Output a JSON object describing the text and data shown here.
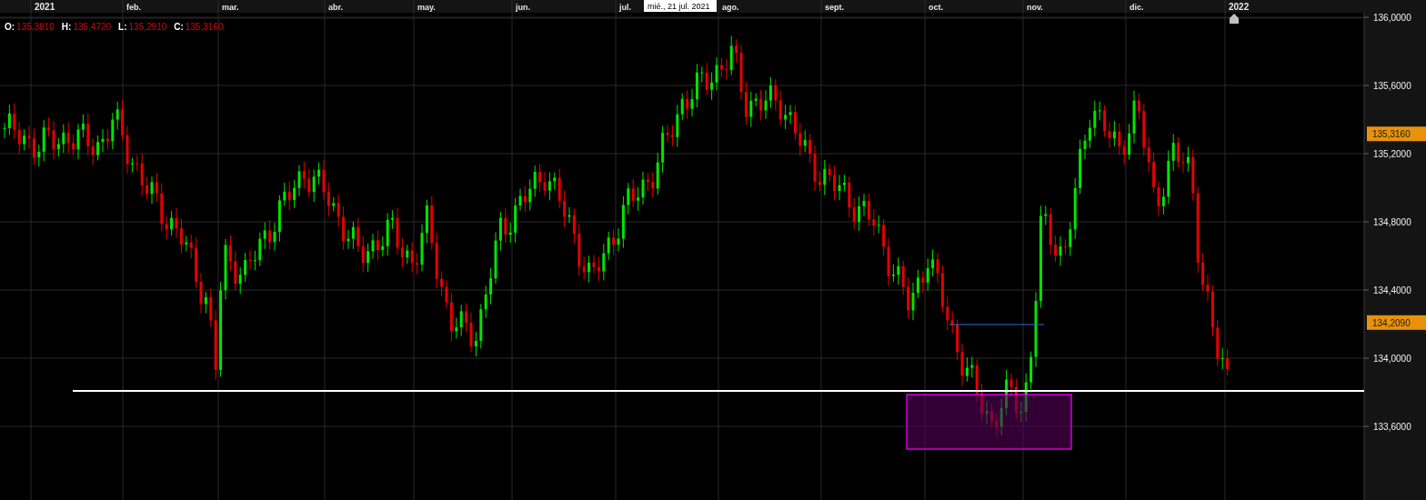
{
  "time_axis": [
    "2021",
    "feb.",
    "mar.",
    "abr.",
    "may.",
    "jun.",
    "jul.",
    "ago.",
    "sept.",
    "oct.",
    "nov.",
    "dic.",
    "2022"
  ],
  "crosshair_date": "mié., 21 jul. 2021",
  "ohlc": [
    {
      "label": "O:",
      "value": "135,3810"
    },
    {
      "label": "H:",
      "value": "135,4720"
    },
    {
      "label": "L:",
      "value": "135,2910"
    },
    {
      "label": "C:",
      "value": "135,3160"
    }
  ],
  "price_axis": [
    "136,0000",
    "135,6000",
    "135,2000",
    "134,8000",
    "134,4000",
    "134,0000",
    "133,6000"
  ],
  "price_tags": [
    "135,3160",
    "134,2090"
  ]
}
